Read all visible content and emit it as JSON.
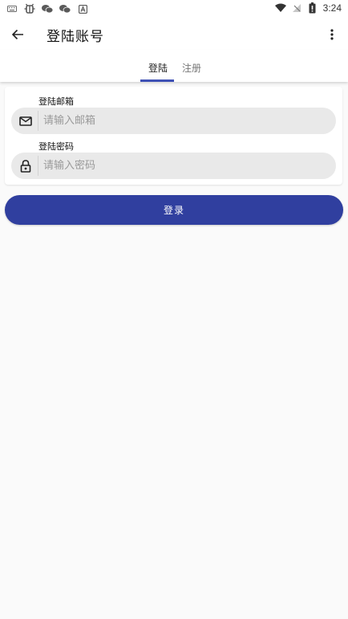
{
  "status_bar": {
    "time": "3:24",
    "left_icons": [
      "keyboard-icon",
      "bug-icon",
      "wechat-icon",
      "wechat-icon",
      "a-badge-icon"
    ],
    "right_icons": [
      "wifi-icon",
      "no-sim-icon",
      "battery-icon"
    ]
  },
  "toolbar": {
    "title": "登陆账号",
    "back_icon": "arrow-left-icon",
    "more_icon": "more-vert-icon"
  },
  "tabs": [
    {
      "label": "登陆",
      "selected": true
    },
    {
      "label": "注册",
      "selected": false
    }
  ],
  "form": {
    "email": {
      "label": "登陆邮箱",
      "placeholder": "请输入邮箱",
      "value": "",
      "icon": "mail-icon"
    },
    "password": {
      "label": "登陆密码",
      "placeholder": "请输入密码",
      "value": "",
      "icon": "lock-icon"
    }
  },
  "login_button": {
    "label": "登录"
  },
  "colors": {
    "accent": "#303f9f",
    "tab_indicator": "#3f51b5",
    "background": "#fafafa",
    "field_background": "#e9e9e9"
  }
}
